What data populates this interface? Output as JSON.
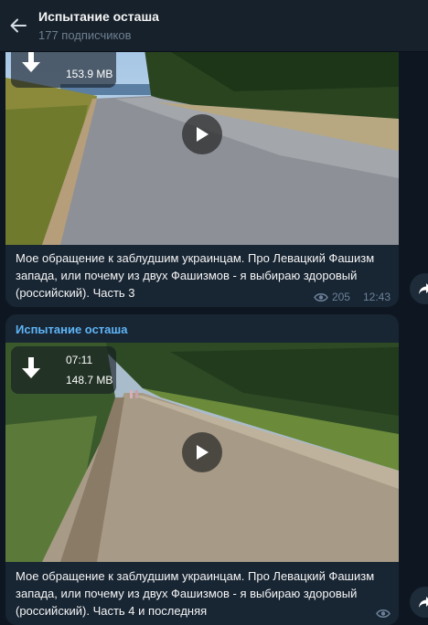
{
  "header": {
    "title": "Испытание осташа",
    "subscribers": "177 подписчиков"
  },
  "messages": [
    {
      "sender": "",
      "file_size": "153.9 MB",
      "caption": "Мое обращение к заблудшим украинцам. Про Левацкий Фашизм запада, или почему из двух Фашизмов - я выбираю здоровый (российский). Часть 3",
      "views": "205",
      "time": "12:43"
    },
    {
      "sender": "Испытание осташа",
      "duration": "07:11",
      "file_size": "148.7 MB",
      "caption": "Мое обращение к заблудшим украинцам. Про Левацкий Фашизм запада, или почему из двух Фашизмов - я выбираю здоровый (российский). Часть 4 и последняя",
      "views": "",
      "time": ""
    }
  ],
  "colors": {
    "background": "#0e1621",
    "bubble": "#182533",
    "header": "#17212b",
    "accent": "#5eb5f7",
    "meta": "#6d8299"
  },
  "icons": {
    "back": "arrow-left-icon",
    "download": "download-icon",
    "play": "play-icon",
    "views": "eye-icon",
    "share": "share-arrow-icon"
  }
}
